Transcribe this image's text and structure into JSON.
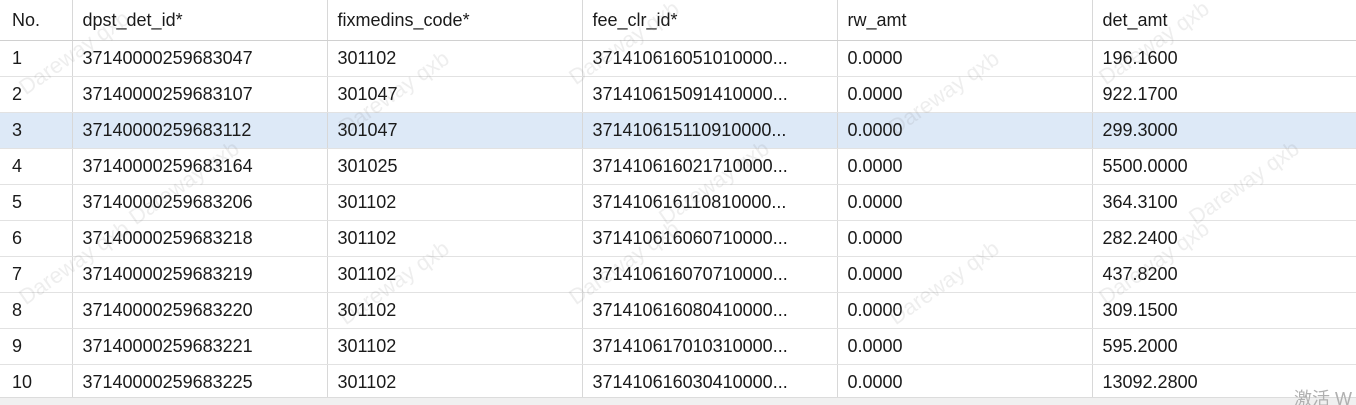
{
  "columns": [
    "No.",
    "dpst_det_id*",
    "fixmedins_code*",
    "fee_clr_id*",
    "rw_amt",
    "det_amt"
  ],
  "rows": [
    [
      "1",
      "37140000259683047",
      "301102",
      "371410616051010000...",
      "0.0000",
      "196.1600"
    ],
    [
      "2",
      "37140000259683107",
      "301047",
      "371410615091410000...",
      "0.0000",
      "922.1700"
    ],
    [
      "3",
      "37140000259683112",
      "301047",
      "371410615110910000...",
      "0.0000",
      "299.3000"
    ],
    [
      "4",
      "37140000259683164",
      "301025",
      "371410616021710000...",
      "0.0000",
      "5500.0000"
    ],
    [
      "5",
      "37140000259683206",
      "301102",
      "371410616110810000...",
      "0.0000",
      "364.3100"
    ],
    [
      "6",
      "37140000259683218",
      "301102",
      "371410616060710000...",
      "0.0000",
      "282.2400"
    ],
    [
      "7",
      "37140000259683219",
      "301102",
      "371410616070710000...",
      "0.0000",
      "437.8200"
    ],
    [
      "8",
      "37140000259683220",
      "301102",
      "371410616080410000...",
      "0.0000",
      "309.1500"
    ],
    [
      "9",
      "37140000259683221",
      "301102",
      "371410617010310000...",
      "0.0000",
      "595.2000"
    ],
    [
      "10",
      "37140000259683225",
      "301102",
      "371410616030410000...",
      "0.0000",
      "13092.2800"
    ]
  ],
  "selected_row": 3,
  "watermark_text": "Dareway qxb",
  "corner_text": "激活 W",
  "colors": {
    "selected_row_bg": "#dde9f7",
    "grid_line": "#d8d8d8"
  }
}
